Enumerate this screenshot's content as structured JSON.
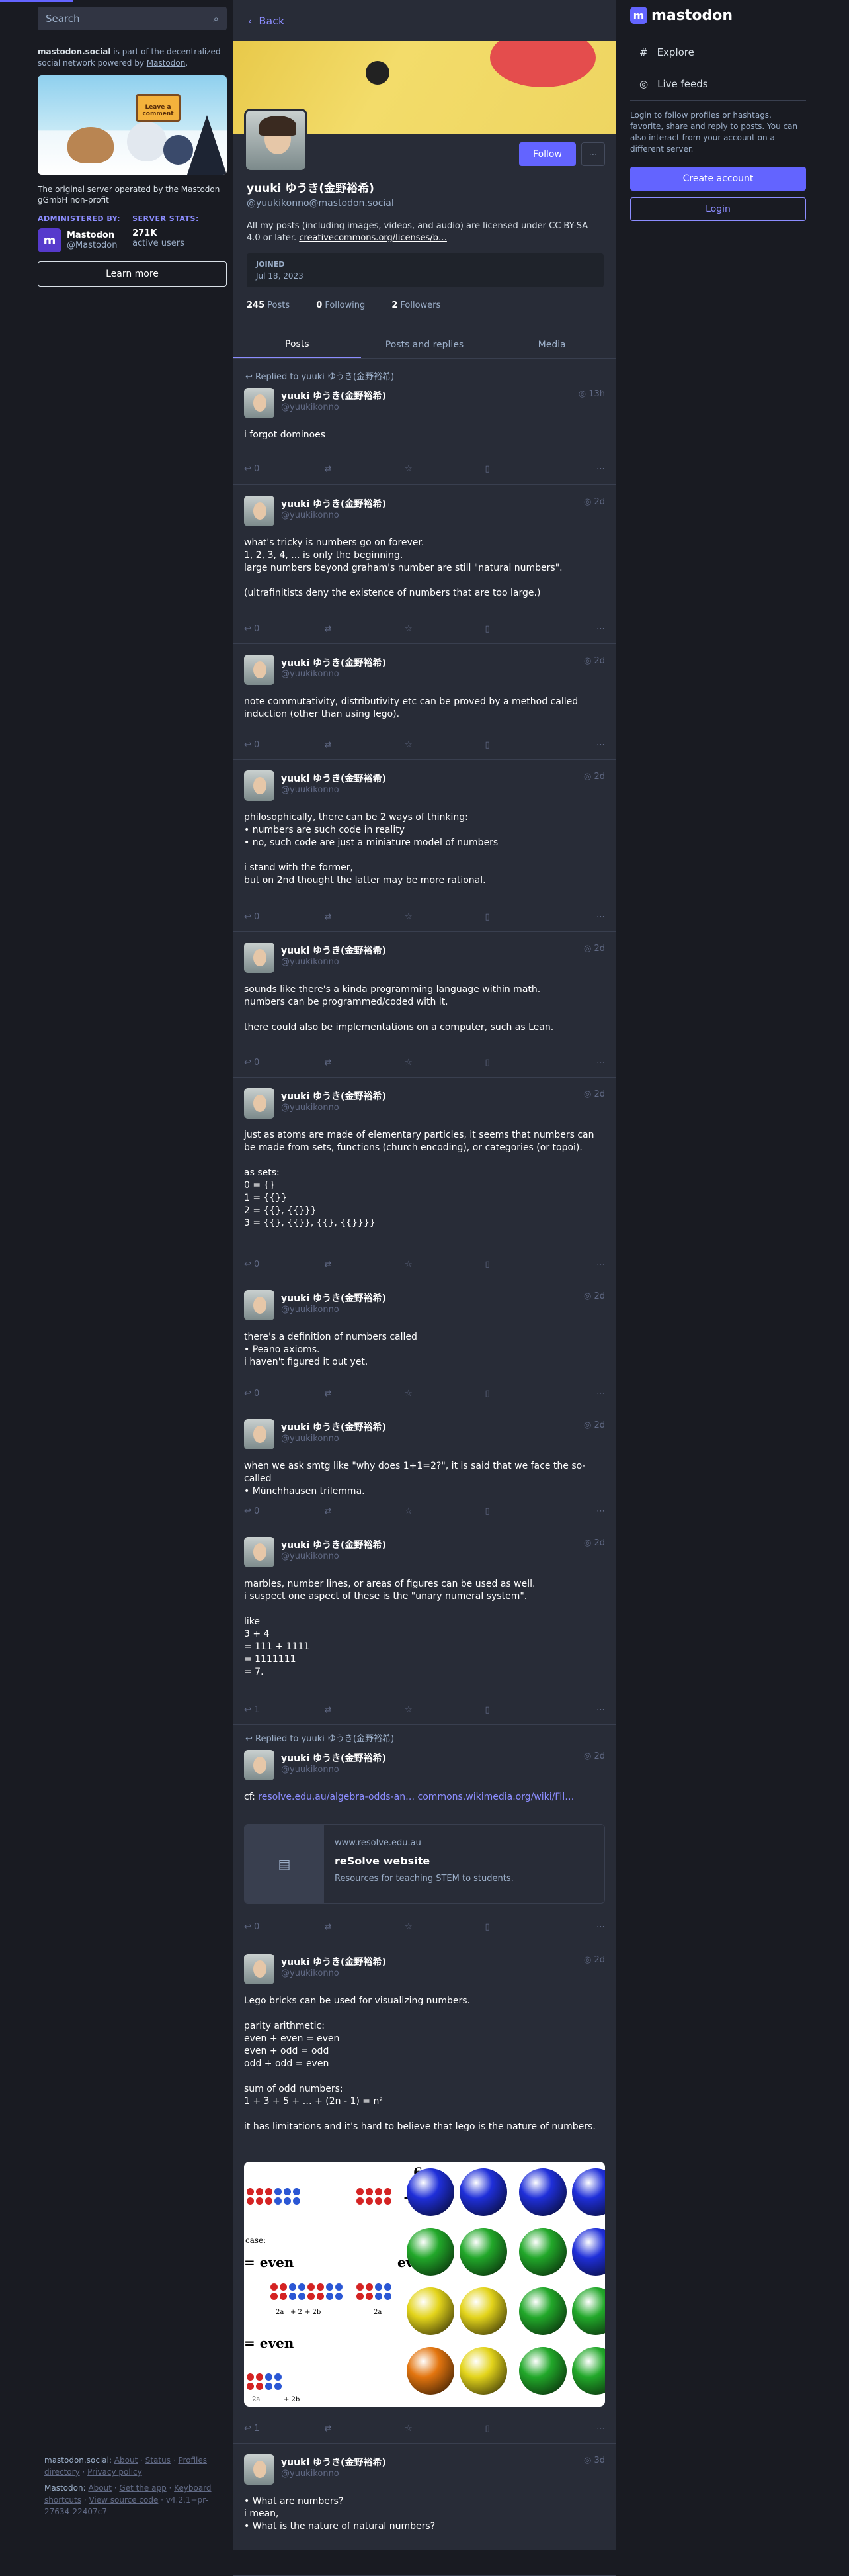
{
  "search": {
    "placeholder": "Search"
  },
  "server": {
    "domain": "mastodon.social",
    "desc_text": " is part of the decentralized social network powered by ",
    "brand": "Mastodon",
    "sign": "Leave a comment",
    "tagline": "The original server operated by the Mastodon gGmbH non-profit",
    "admin_label": "ADMINISTERED BY:",
    "stats_label": "SERVER STATS:",
    "admin_name": "Mastodon",
    "admin_handle": "@Mastodon",
    "users": "271K",
    "users_label": "active users",
    "learn_more": "Learn more"
  },
  "back": "Back",
  "profile": {
    "name": "yuuki ゆうき(金野裕希)",
    "handle": "@yuukikonno@mastodon.social",
    "follow": "Follow",
    "bio": "All my posts (including images, videos, and audio) are licensed under CC BY-SA 4.0 or later.",
    "bio_link": "creativecommons.org/licenses/b…",
    "joined_label": "JOINED",
    "joined": "Jul 18, 2023",
    "posts": "245",
    "posts_label": "Posts",
    "following": "0",
    "following_label": "Following",
    "followers": "2",
    "followers_label": "Followers"
  },
  "tabs": [
    "Posts",
    "Posts and replies",
    "Media"
  ],
  "replied": "Replied to yuuki ゆうき(金野裕希)",
  "author": {
    "name": "yuuki ゆうき(金野裕希)",
    "handle": "@yuukikonno"
  },
  "posts": [
    {
      "time": "13h",
      "body": "i forgot dominoes",
      "replies": "0"
    },
    {
      "time": "2d",
      "body": "what's tricky is numbers go on forever.\n1, 2, 3, 4, ... is only the beginning.\nlarge numbers beyond graham's number are still \"natural numbers\".\n\n(ultrafinitists deny the existence of numbers that are too large.)",
      "replies": "0"
    },
    {
      "time": "2d",
      "body": "note commutativity, distributivity etc can be proved by a method called induction (other than using lego).",
      "replies": "0"
    },
    {
      "time": "2d",
      "body": "philosophically, there can be 2 ways of thinking:\n• numbers are such code in reality\n• no, such code are just a miniature model of numbers\n\ni stand with the former,\nbut on 2nd thought the latter may be more rational.",
      "replies": "0"
    },
    {
      "time": "2d",
      "body": "sounds like there's a kinda programming language within math.\nnumbers can be programmed/coded with it.\n\nthere could also be implementations on a computer, such as Lean.",
      "replies": "0"
    },
    {
      "time": "2d",
      "body": "just as atoms are made of elementary particles, it seems that numbers can be made from sets, functions (church encoding), or categories (or topoi).\n\nas sets:\n0 = {}\n1 = {{}}\n2 = {{}, {{}}}\n3 = {{}, {{}}, {{}, {{}}}}",
      "replies": "0"
    },
    {
      "time": "2d",
      "body": "there's a definition of numbers called\n• Peano axioms.\ni haven't figured it out yet.",
      "replies": "0"
    },
    {
      "time": "2d",
      "body": "when we ask smtg like \"why does 1+1=2?\", it is said that we face the so-called\n• Münchhausen trilemma.",
      "replies": "0"
    },
    {
      "time": "2d",
      "body": "marbles, number lines, or areas of figures can be used as well.\ni suspect one aspect of these is the \"unary numeral system\".\n\nlike\n3 + 4\n= 111 + 1111\n= 1111111\n= 7.",
      "replies": "1"
    },
    {
      "time": "2d",
      "body": "cf: ",
      "link1": "resolve.edu.au/algebra-odds-an…",
      "link2": "commons.wikimedia.org/wiki/Fil…",
      "card_domain": "www.resolve.edu.au",
      "card_title": "reSolve website",
      "card_desc": "Resources for teaching STEM to students.",
      "replies": "0"
    },
    {
      "time": "2d",
      "body": "Lego bricks can be used for visualizing numbers.\n\nparity arithmetic:\neven + even = even\neven + odd = odd\nodd + odd = even\n\nsum of odd numbers:\n1 + 3 + 5 + … + (2n - 1) = n²\n\nit has limitations and it's hard to believe that lego is the nature of numbers.",
      "media_a": {
        "case": "case:",
        "even1": "= even",
        "even2": "even",
        "even3": "= even",
        "six": "6",
        "l1": "2a",
        "l2": "+ 2",
        "l3": "+ 2b",
        "l4": "2a",
        "l5": "2a",
        "l6": "+ 2b"
      },
      "replies": "1"
    },
    {
      "time": "3d",
      "body": "• What are numbers?\ni mean,\n• What is the nature of natural numbers?"
    }
  ],
  "right": {
    "logo": "mastodon",
    "explore": "Explore",
    "live": "Live feeds",
    "note": "Login to follow profiles or hashtags, favorite, share and reply to posts. You can also interact from your account on a different server.",
    "create": "Create account",
    "login": "Login"
  },
  "footer": {
    "server": "mastodon.social:",
    "about": "About",
    "status": "Status",
    "profiles": "Profiles directory",
    "privacy": "Privacy policy",
    "mastodon": "Mastodon:",
    "about2": "About",
    "getapp": "Get the app",
    "keys": "Keyboard shortcuts",
    "source": "View source code",
    "version": "v4.2.1+pr-27634-22407c7"
  },
  "colors": {
    "bg": "#191b22",
    "panel": "#282c37",
    "accent": "#6364ff",
    "link": "#8c8dff"
  }
}
